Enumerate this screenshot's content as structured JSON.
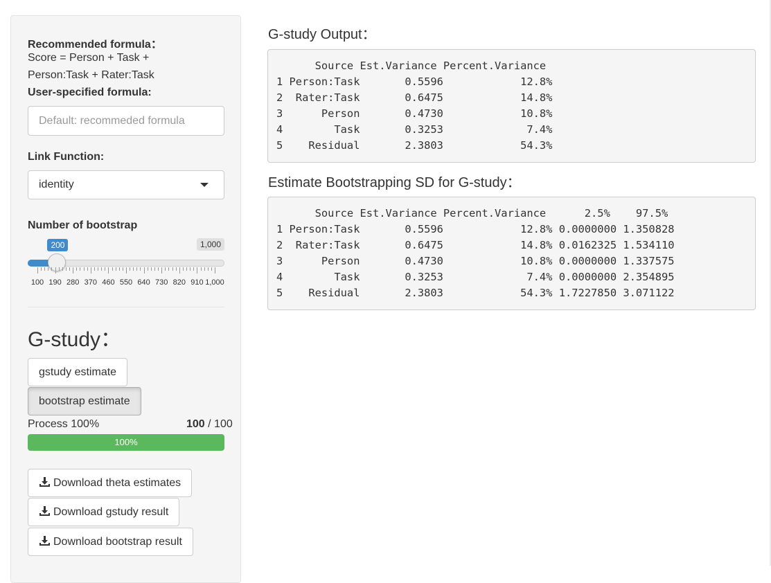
{
  "sidebar": {
    "recommended_label": "Recommended formula：",
    "recommended_line1": "Score = Person + Task +",
    "recommended_line2": "Person:Task + Rater:Task",
    "user_formula_label": "User-specified formula:",
    "user_formula_placeholder": "Default: recommeded formula",
    "user_formula_value": "",
    "link_label": "Link Function:",
    "link_value": "identity",
    "bootstrap_label": "Number of bootstrap",
    "bootstrap_value": "200",
    "bootstrap_max": "1,000",
    "bootstrap_value_num": 200,
    "bootstrap_min_num": 100,
    "bootstrap_max_num": 1000,
    "tick_labels": [
      "100",
      "190",
      "280",
      "370",
      "460",
      "550",
      "640",
      "730",
      "820",
      "910",
      "1,000"
    ],
    "gstudy_heading": "G-study：",
    "gstudy_button": "gstudy estimate",
    "bootstrap_button": "bootstrap estimate",
    "process_label": "Process 100%",
    "process_done": "100",
    "process_total": "/ 100",
    "progress_text": "100%",
    "progress_fraction": 1.0,
    "download_theta": "Download theta estimates",
    "download_gstudy": "Download gstudy result",
    "download_bootstrap": "Download bootstrap result"
  },
  "main": {
    "gstudy_output_title": "G-study Output：",
    "gstudy_output_text": "      Source Est.Variance Percent.Variance\n1 Person:Task       0.5596            12.8%\n2  Rater:Task       0.6475            14.8%\n3      Person       0.4730            10.8%\n4        Task       0.3253             7.4%\n5    Residual       2.3803            54.3%",
    "bootstrap_sd_title": "Estimate Bootstrapping SD for G-study：",
    "bootstrap_sd_text": "      Source Est.Variance Percent.Variance      2.5%    97.5%\n1 Person:Task       0.5596            12.8% 0.0000000 1.350828\n2  Rater:Task       0.6475            14.8% 0.0162325 1.534110\n3      Person       0.4730            10.8% 0.0000000 1.337575\n4        Task       0.3253             7.4% 0.0000000 2.354895\n5    Residual       2.3803            54.3% 1.7227850 3.071122"
  },
  "colors": {
    "slider_accent": "#428bca",
    "progress_fill": "#5cb85c",
    "max_bubble_bg": "#e0e0e0"
  },
  "icons": {
    "download": "download-icon",
    "caret": "caret-down-icon"
  }
}
